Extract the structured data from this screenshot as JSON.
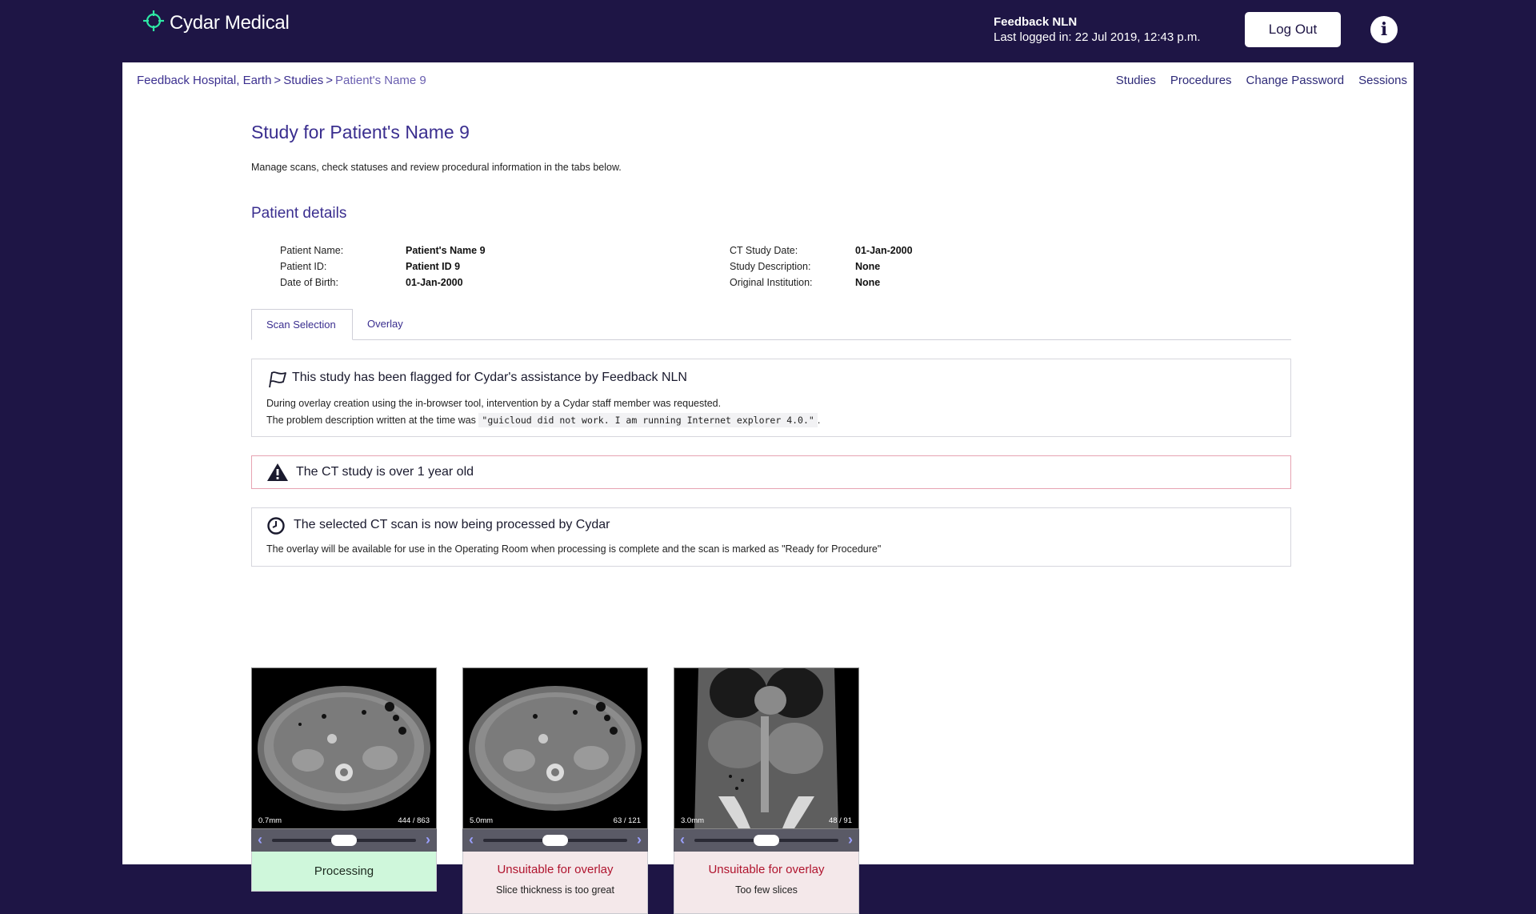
{
  "header": {
    "brand": "Cydar Medical",
    "user_name": "Feedback NLN",
    "last_logged": "Last logged in: 22 Jul 2019, 12:43 p.m.",
    "logout_label": "Log Out",
    "info_label": "i"
  },
  "breadcrumb": {
    "items": [
      "Feedback Hospital, Earth",
      "Studies",
      "Patient's Name 9"
    ],
    "separator": ">"
  },
  "nav": [
    "Studies",
    "Procedures",
    "Change Password",
    "Sessions"
  ],
  "page": {
    "title": "Study for Patient's Name 9",
    "subtitle": "Manage scans, check statuses and review procedural information in the tabs below.",
    "details_title": "Patient details"
  },
  "details": {
    "left": [
      {
        "label": "Patient Name:",
        "value": "Patient's Name 9"
      },
      {
        "label": "Patient ID:",
        "value": "Patient ID 9"
      },
      {
        "label": "Date of Birth:",
        "value": "01-Jan-2000"
      }
    ],
    "right": [
      {
        "label": "CT Study Date:",
        "value": "01-Jan-2000"
      },
      {
        "label": "Study Description:",
        "value": "None"
      },
      {
        "label": "Original Institution:",
        "value": "None"
      }
    ]
  },
  "tabs": [
    {
      "label": "Scan Selection",
      "active": true
    },
    {
      "label": "Overlay",
      "active": false
    }
  ],
  "alerts": {
    "flag": {
      "title": "This study has been flagged for Cydar's assistance by Feedback NLN",
      "line1": "During overlay creation using the in-browser tool, intervention by a Cydar staff member was requested.",
      "line2_prefix": "The problem description written at the time was",
      "line2_code": "\"guicloud did not work. I am running Internet explorer 4.0.\"",
      "line2_suffix": "."
    },
    "warn": {
      "title": "The CT study is over 1 year old"
    },
    "processing": {
      "title": "The selected CT scan is now being processed by Cydar",
      "line1": "The overlay will be available for use in the Operating Room when processing is complete and the scan is marked as \"Ready for Procedure\""
    }
  },
  "scans": [
    {
      "thickness": "0.7mm",
      "count": "444 / 863",
      "slider_position": 0.5,
      "view": "axial",
      "status": "Processing",
      "status_type": "ok",
      "reason": ""
    },
    {
      "thickness": "5.0mm",
      "count": "63 / 121",
      "slider_position": 0.5,
      "view": "axial",
      "status": "Unsuitable for overlay",
      "status_type": "bad",
      "reason": "Slice thickness is too great"
    },
    {
      "thickness": "3.0mm",
      "count": "48 / 91",
      "slider_position": 0.5,
      "view": "coronal",
      "status": "Unsuitable for overlay",
      "status_type": "bad",
      "reason": "Too few slices"
    }
  ],
  "colors": {
    "brand_dark": "#1e1545",
    "accent_purple": "#3a2e8f",
    "logo_green": "#2ee8a5",
    "processing_bg": "#cff7db",
    "unsuitable_text": "#b0142e",
    "warning_border": "#e7a3b2"
  },
  "icons": {
    "flag": "flag-icon",
    "warning": "warning-triangle-icon",
    "processing": "clock-icon",
    "info": "info-icon",
    "logo": "crosshair-logo-icon"
  }
}
